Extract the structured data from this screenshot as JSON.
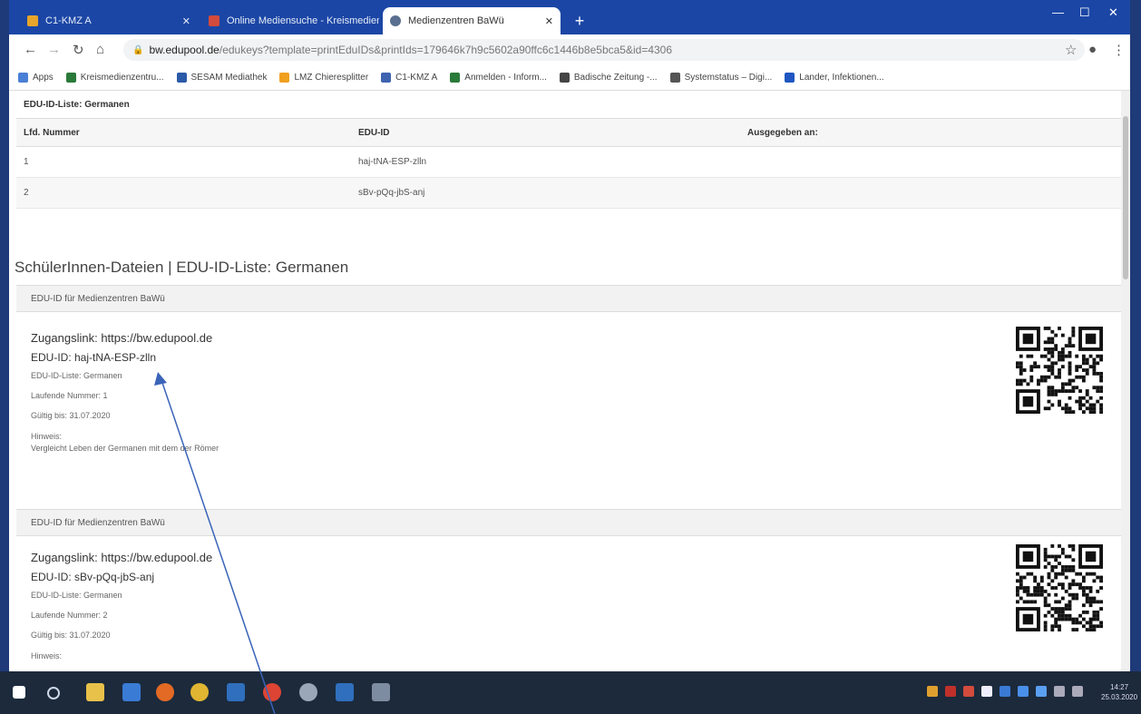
{
  "browser": {
    "tabs": [
      {
        "label": "C1-KMZ A",
        "active": false
      },
      {
        "label": "Online Mediensuche - Kreismedienzentrum",
        "active": false
      },
      {
        "label": "Medienzentren BaWü",
        "active": true
      }
    ],
    "new_tab": "+",
    "url_domain": "bw.edupool.de",
    "url_rest": "/edukeys?template=printEduIDs&printIds=179646k7h9c5602a90ffc6c1446b8e5bca5&id=4306",
    "bookmarks": [
      {
        "label": "Apps",
        "color": "#4a7fd6"
      },
      {
        "label": "Kreismedienzentru...",
        "color": "#2a7a3a"
      },
      {
        "label": "SESAM Mediathek",
        "color": "#2a5aa8"
      },
      {
        "label": "LMZ Chieresplitter",
        "color": "#f0a020"
      },
      {
        "label": "C1-KMZ A",
        "color": "#3e63b0"
      },
      {
        "label": "Anmelden - Inform...",
        "color": "#2a7a3a"
      },
      {
        "label": "Badische Zeitung -...",
        "color": "#444444"
      },
      {
        "label": "Systemstatus – Digi...",
        "color": "#555555"
      },
      {
        "label": "Lander, Infektionen...",
        "color": "#1f56c2"
      }
    ]
  },
  "list": {
    "title": "EDU-ID-Liste: Germanen",
    "headers": [
      "Lfd. Nummer",
      "EDU-ID",
      "Ausgegeben an:"
    ],
    "rows": [
      {
        "nr": "1",
        "id": "haj-tNA-ESP-zlln",
        "to": ""
      },
      {
        "nr": "2",
        "id": "sBv-pQq-jbS-anj",
        "to": ""
      }
    ]
  },
  "section_heading": "SchülerInnen-Dateien | EDU-ID-Liste: Germanen",
  "cards": [
    {
      "header": "EDU-ID für Medienzentren BaWü",
      "zugangslink": "Zugangslink: https://bw.edupool.de",
      "eduid": "EDU-ID: haj-tNA-ESP-zlln",
      "liste": "EDU-ID-Liste: Germanen",
      "nummer": "Laufende Nummer: 1",
      "gueltig": "Gültig bis: 31.07.2020",
      "hinweis_label": "Hinweis:",
      "hinweis": "Vergleicht Leben der Germanen mit dem der Römer"
    },
    {
      "header": "EDU-ID für Medienzentren BaWü",
      "zugangslink": "Zugangslink: https://bw.edupool.de",
      "eduid": "EDU-ID: sBv-pQq-jbS-anj",
      "liste": "EDU-ID-Liste: Germanen",
      "nummer": "Laufende Nummer: 2",
      "gueltig": "Gültig bis: 31.07.2020",
      "hinweis_label": "Hinweis:"
    }
  ],
  "clock": {
    "time": "14:27",
    "date": "25.03.2020"
  },
  "colors": {
    "tabbar": "#1b46a5",
    "taskbar": "#1c2a3c",
    "arrow": "#3a64b8"
  }
}
